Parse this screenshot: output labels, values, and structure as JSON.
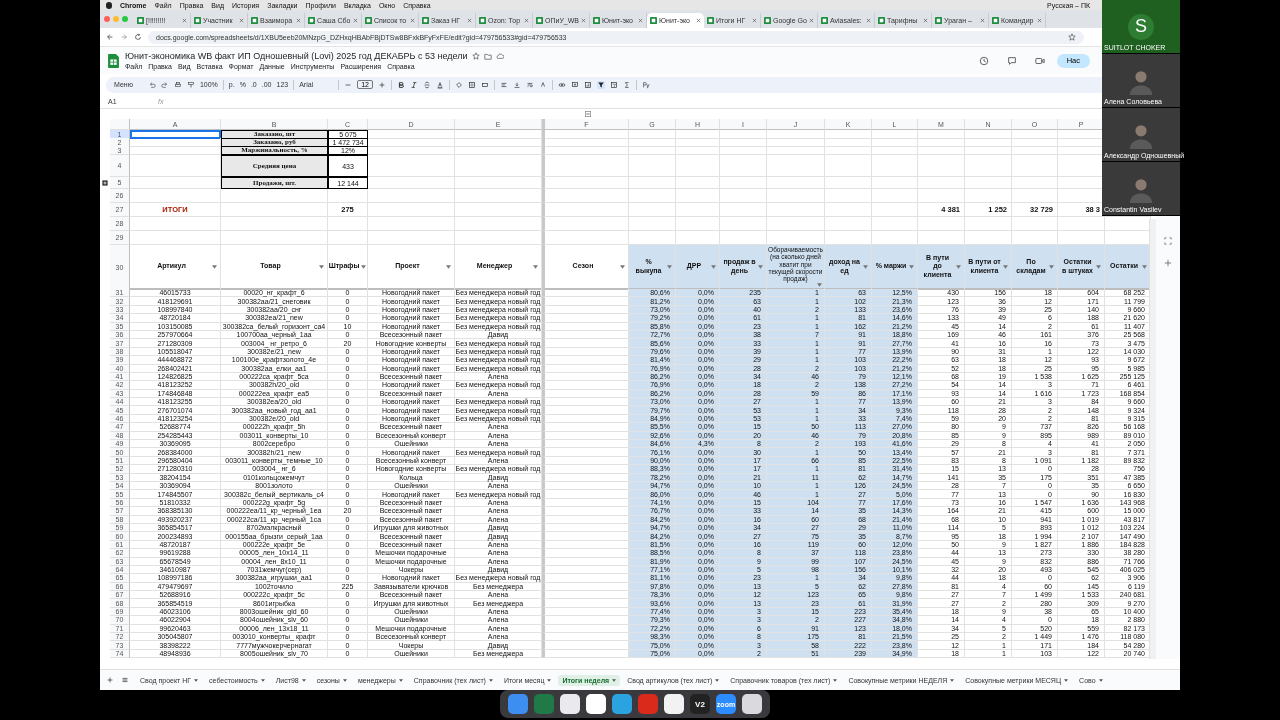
{
  "menubar": {
    "app": "Chrome",
    "items": [
      "Файл",
      "Правка",
      "Вид",
      "История",
      "Закладки",
      "Профили",
      "Вкладка",
      "Окно",
      "Справка"
    ],
    "input_source": "Русская – ПК"
  },
  "browser_tabs": [
    {
      "title": "[!!!!!!!!!",
      "selected": false
    },
    {
      "title": "Участник",
      "selected": false
    },
    {
      "title": "Взаимора",
      "selected": false
    },
    {
      "title": "Саша Сбо",
      "selected": false
    },
    {
      "title": "Список то",
      "selected": false
    },
    {
      "title": "Заказ НГ",
      "selected": false
    },
    {
      "title": "Ozon: Тор",
      "selected": false
    },
    {
      "title": "ОПиУ_WB",
      "selected": false
    },
    {
      "title": "Юнит-эко",
      "selected": false
    },
    {
      "title": "Юнит-эко",
      "selected": true
    },
    {
      "title": "Итоги НГ",
      "selected": false
    },
    {
      "title": "Google Go",
      "selected": false
    },
    {
      "title": "Aviasales:",
      "selected": false
    },
    {
      "title": "Тарифны",
      "selected": false
    },
    {
      "title": "Ураган –",
      "selected": false
    },
    {
      "title": "Командир",
      "selected": false
    }
  ],
  "address_bar": {
    "url": "docs.google.com/spreadsheets/d/1XBU5eeb20MNzpG_DZHxqHBAbFBjDTSw8BFxkBFyFxFE/edit?gid=479756533#gid=479756533"
  },
  "document": {
    "title": "Юнит-экономика WB факт ИП Одношевный (Lovi) 2025 год ДЕКАБРЬ с 53 недели",
    "menus": [
      "Файл",
      "Правка",
      "Вид",
      "Вставка",
      "Формат",
      "Данные",
      "Инструменты",
      "Расширения",
      "Справка"
    ],
    "share_label": "Нас"
  },
  "toolbar": {
    "search": "Меню",
    "zoom": "100%",
    "currency": "р.",
    "percent": "%",
    "decrease_decimals": ".0",
    "increase_decimals": ".00",
    "format": "123",
    "font": "Arial",
    "font_size": "12"
  },
  "formula_bar": {
    "cell": "A1",
    "fx": "fx"
  },
  "sheet": {
    "columns": [
      {
        "letter": "A",
        "header": "Артикул",
        "shaded": false,
        "header_shaded": false
      },
      {
        "letter": "B",
        "header": "Товар",
        "shaded": false,
        "header_shaded": false
      },
      {
        "letter": "C",
        "header": "Штрафы",
        "shaded": false,
        "header_shaded": false
      },
      {
        "letter": "D",
        "header": "Проект",
        "shaded": false,
        "header_shaded": false
      },
      {
        "letter": "E",
        "header": "Менеджер",
        "shaded": false,
        "header_shaded": false
      },
      {
        "letter": "F",
        "header": "Сезон",
        "shaded": false,
        "header_shaded": false
      },
      {
        "letter": "G",
        "header": "% выкупа",
        "shaded": true,
        "header_shaded": true
      },
      {
        "letter": "H",
        "header": "ДРР",
        "shaded": true,
        "header_shaded": true
      },
      {
        "letter": "I",
        "header": "продаж в день",
        "shaded": true,
        "header_shaded": true
      },
      {
        "letter": "J",
        "header": "Оборачиваемость (на сколько дней хватит при текущей скорости продаж)",
        "kind": "small",
        "shaded": true,
        "header_shaded": true
      },
      {
        "letter": "K",
        "header": "доход на ед",
        "shaded": true,
        "header_shaded": true
      },
      {
        "letter": "L",
        "header": "% маржи",
        "shaded": true,
        "header_shaded": true
      },
      {
        "letter": "M",
        "header": "В пути до клиента",
        "shaded": false,
        "header_shaded": true
      },
      {
        "letter": "N",
        "header": "В пути от клиента",
        "shaded": false,
        "header_shaded": true
      },
      {
        "letter": "O",
        "header": "По складам",
        "shaded": false,
        "header_shaded": true
      },
      {
        "letter": "P",
        "header": "Остатки в штуках",
        "shaded": false,
        "header_shaded": true
      },
      {
        "header": "Остатки",
        "shaded": false,
        "header_shaded": true
      }
    ],
    "summary": [
      {
        "row": "1",
        "label": "Заказано, шт",
        "value": "5 075"
      },
      {
        "row": "2",
        "label": "Заказано, руб",
        "value": "1 472 734"
      },
      {
        "row": "3",
        "label": "Маржинальность, %",
        "value": "12%"
      },
      {
        "row": "4",
        "label": "Средняя цена",
        "value": "433"
      },
      {
        "row": "5",
        "label": "Продажи, шт.",
        "value": "12 144"
      }
    ],
    "blank_rows_before": [
      "26"
    ],
    "totals": {
      "row": "27",
      "label": "ИТОГИ",
      "fines": "275",
      "to_client": "4 381",
      "from_client": "1 252",
      "warehouses": "32 729",
      "stock_units": "38 3"
    },
    "blank_rows_after": [
      "28",
      "29"
    ],
    "header_row": "30",
    "rows": [
      {
        "row": "31",
        "frozen": [
          "46015733",
          "00020_нг_крафт_6",
          "0",
          "Новогодний пакет",
          "Без менеджера новый год"
        ],
        "values": [
          "80,6%",
          "0,0%",
          "235",
          "1",
          "63",
          "12,5%",
          "430",
          "156",
          "18",
          "604",
          "68 252"
        ]
      },
      {
        "row": "32",
        "frozen": [
          "418129691",
          "300382aa/21_снеговик",
          "0",
          "Новогодний пакет",
          "Без менеджера новый год"
        ],
        "values": [
          "81,2%",
          "0,0%",
          "63",
          "1",
          "102",
          "21,3%",
          "123",
          "36",
          "12",
          "171",
          "11 799"
        ]
      },
      {
        "row": "33",
        "frozen": [
          "108997840",
          "300382aa/20_снг",
          "0",
          "Новогодний пакет",
          "Без менеджера новый год"
        ],
        "values": [
          "73,0%",
          "0,0%",
          "40",
          "2",
          "133",
          "23,6%",
          "76",
          "39",
          "25",
          "140",
          "9 660"
        ]
      },
      {
        "row": "34",
        "frozen": [
          "48720184",
          "300382ea/21_new",
          "0",
          "Новогодний пакет",
          "Без менеджера новый год"
        ],
        "values": [
          "79,2%",
          "0,0%",
          "61",
          "1",
          "81",
          "14,6%",
          "133",
          "49",
          "6",
          "188",
          "21 620"
        ]
      },
      {
        "row": "35",
        "frozen": [
          "103150085",
          "300382ca_белый_горизонт_ca4",
          "10",
          "Новогодний пакет",
          "Без менеджера новый год"
        ],
        "values": [
          "85,8%",
          "0,0%",
          "23",
          "1",
          "162",
          "21,2%",
          "45",
          "14",
          "2",
          "61",
          "11 407"
        ]
      },
      {
        "row": "36",
        "frozen": [
          "257970664",
          "100700aa_черный_1aa",
          "0",
          "Всесезонный пакет",
          "Давид"
        ],
        "values": [
          "72,7%",
          "0,0%",
          "38",
          "7",
          "91",
          "18,8%",
          "169",
          "46",
          "161",
          "376",
          "25 568"
        ]
      },
      {
        "row": "37",
        "frozen": [
          "271280309",
          "003004_ нг_ретро_6",
          "20",
          "Новогодние конверты",
          "Без менеджера новый год"
        ],
        "values": [
          "85,6%",
          "0,0%",
          "33",
          "1",
          "91",
          "27,7%",
          "41",
          "16",
          "16",
          "73",
          "3 475"
        ]
      },
      {
        "row": "38",
        "frozen": [
          "105518047",
          "300382e/21_new",
          "0",
          "Новогодний пакет",
          "Без менеджера новый год"
        ],
        "values": [
          "79,6%",
          "0,0%",
          "39",
          "1",
          "77",
          "13,9%",
          "90",
          "31",
          "1",
          "122",
          "14 030"
        ]
      },
      {
        "row": "39",
        "frozen": [
          "444468872",
          "100100e_крафтзолото_4e",
          "0",
          "Новогодний пакет",
          "Без менеджера новый год"
        ],
        "values": [
          "81,4%",
          "0,0%",
          "29",
          "1",
          "103",
          "22,2%",
          "63",
          "18",
          "12",
          "93",
          "9 672"
        ]
      },
      {
        "row": "40",
        "frozen": [
          "268402421",
          "300382aa_елки_aa1",
          "0",
          "Новогодний пакет",
          "Без менеджера новый год"
        ],
        "values": [
          "76,9%",
          "0,0%",
          "28",
          "2",
          "103",
          "21,2%",
          "52",
          "18",
          "25",
          "95",
          "5 985"
        ]
      },
      {
        "row": "41",
        "frozen": [
          "124826825",
          "000222ca_крафт_5ca",
          "0",
          "Всесезонный пакет",
          "Алена"
        ],
        "values": [
          "86,2%",
          "0,0%",
          "34",
          "46",
          "79",
          "12,1%",
          "68",
          "19",
          "1 538",
          "1 625",
          "255 125"
        ]
      },
      {
        "row": "42",
        "frozen": [
          "418123252",
          "300382h/20_old",
          "0",
          "Новогодний пакет",
          "Без менеджера новый год"
        ],
        "values": [
          "76,9%",
          "0,0%",
          "18",
          "2",
          "138",
          "27,2%",
          "54",
          "14",
          "3",
          "71",
          "6 461"
        ]
      },
      {
        "row": "43",
        "frozen": [
          "174846848",
          "000222ea_крафт_ea5",
          "0",
          "Всесезонный пакет",
          "Алена"
        ],
        "values": [
          "86,2%",
          "0,0%",
          "28",
          "59",
          "86",
          "17,1%",
          "93",
          "14",
          "1 616",
          "1 723",
          "168 854"
        ]
      },
      {
        "row": "44",
        "frozen": [
          "418123255",
          "300382ea/20_old",
          "0",
          "Новогодний пакет",
          "Без менеджера новый год"
        ],
        "values": [
          "73,0%",
          "0,0%",
          "27",
          "1",
          "77",
          "13,9%",
          "60",
          "21",
          "3",
          "84",
          "9 660"
        ]
      },
      {
        "row": "45",
        "frozen": [
          "276701074",
          "300382aa_новый_год_aa1",
          "0",
          "Новогодний пакет",
          "Без менеджера новый год"
        ],
        "values": [
          "79,7%",
          "0,0%",
          "53",
          "1",
          "34",
          "9,3%",
          "118",
          "28",
          "2",
          "148",
          "9 324"
        ]
      },
      {
        "row": "46",
        "frozen": [
          "418123254",
          "300382e/20_old",
          "0",
          "Новогодний пакет",
          "Без менеджера новый год"
        ],
        "values": [
          "84,9%",
          "0,0%",
          "53",
          "1",
          "33",
          "7,4%",
          "59",
          "20",
          "2",
          "81",
          "9 315"
        ]
      },
      {
        "row": "47",
        "frozen": [
          "52688774",
          "000222h_крафт_5h",
          "0",
          "Всесезонный пакет",
          "Алена"
        ],
        "values": [
          "85,5%",
          "0,0%",
          "15",
          "50",
          "113",
          "27,0%",
          "80",
          "9",
          "737",
          "826",
          "56 168"
        ]
      },
      {
        "row": "48",
        "frozen": [
          "254285443",
          "003011_конверты_10",
          "0",
          "Всесезонный конверт",
          "Алена"
        ],
        "values": [
          "92,6%",
          "0,0%",
          "20",
          "46",
          "79",
          "20,8%",
          "85",
          "9",
          "895",
          "989",
          "89 010"
        ]
      },
      {
        "row": "49",
        "frozen": [
          "30369095",
          "8002серебро",
          "0",
          "Ошейники",
          "Алена"
        ],
        "values": [
          "84,6%",
          "4,3%",
          "8",
          "2",
          "193",
          "41,6%",
          "29",
          "8",
          "4",
          "41",
          "2 050"
        ]
      },
      {
        "row": "50",
        "frozen": [
          "268384000",
          "300382h/21_new",
          "0",
          "Новогодний пакет",
          "Без менеджера новый год"
        ],
        "values": [
          "76,1%",
          "0,0%",
          "30",
          "1",
          "50",
          "13,4%",
          "57",
          "21",
          "3",
          "81",
          "7 371"
        ]
      },
      {
        "row": "51",
        "frozen": [
          "296580404",
          "003011_конверты_темные_10",
          "0",
          "Всесезонный конверт",
          "Алена"
        ],
        "values": [
          "90,0%",
          "0,0%",
          "17",
          "66",
          "85",
          "22,5%",
          "83",
          "8",
          "1 091",
          "1 182",
          "89 832"
        ]
      },
      {
        "row": "52",
        "frozen": [
          "271280310",
          "003004_ нг_6",
          "0",
          "Новогодние конверты",
          "Без менеджера новый год"
        ],
        "values": [
          "88,3%",
          "0,0%",
          "17",
          "1",
          "81",
          "31,4%",
          "15",
          "13",
          "0",
          "28",
          "756"
        ]
      },
      {
        "row": "53",
        "frozen": [
          "38204154",
          "0101кольцожемчут",
          "0",
          "Кольца",
          "Давид"
        ],
        "values": [
          "78,2%",
          "0,0%",
          "21",
          "11",
          "62",
          "14,7%",
          "141",
          "35",
          "175",
          "351",
          "47 385"
        ]
      },
      {
        "row": "54",
        "frozen": [
          "30369094",
          "8001золото",
          "0",
          "Ошейники",
          "Алена"
        ],
        "values": [
          "94,7%",
          "0,0%",
          "10",
          "1",
          "126",
          "24,5%",
          "28",
          "7",
          "0",
          "35",
          "6 650"
        ]
      },
      {
        "row": "55",
        "frozen": [
          "174845507",
          "300382c_белый_вертикаль_c4",
          "0",
          "Новогодний пакет",
          "Без менеджера новый год"
        ],
        "values": [
          "86,0%",
          "0,0%",
          "46",
          "1",
          "27",
          "5,0%",
          "77",
          "13",
          "0",
          "90",
          "16 830"
        ]
      },
      {
        "row": "56",
        "frozen": [
          "51810332",
          "000222g_крафт_5g",
          "0",
          "Всесезонный пакет",
          "Алена"
        ],
        "values": [
          "74,1%",
          "0,0%",
          "15",
          "104",
          "77",
          "17,6%",
          "73",
          "16",
          "1 547",
          "1 636",
          "143 968"
        ]
      },
      {
        "row": "57",
        "frozen": [
          "368385130",
          "000222ea/11_кр_черный_1ea",
          "20",
          "Всесезонный пакет",
          "Алена"
        ],
        "values": [
          "76,7%",
          "0,0%",
          "33",
          "14",
          "35",
          "14,3%",
          "164",
          "21",
          "415",
          "600",
          "15 000"
        ]
      },
      {
        "row": "58",
        "frozen": [
          "493920237",
          "000222ca/11_кр_черный_1ca",
          "0",
          "Всесезонный пакет",
          "Алена"
        ],
        "values": [
          "84,2%",
          "0,0%",
          "16",
          "60",
          "68",
          "21,4%",
          "68",
          "10",
          "941",
          "1 019",
          "43 817"
        ]
      },
      {
        "row": "59",
        "frozen": [
          "365854517",
          "8702мэлкрасный",
          "0",
          "Игрушки для животных",
          "Давид"
        ],
        "values": [
          "94,7%",
          "0,0%",
          "34",
          "27",
          "29",
          "11,0%",
          "114",
          "5",
          "893",
          "1 012",
          "103 224"
        ]
      },
      {
        "row": "60",
        "frozen": [
          "200234893",
          "000155aa_брызги_серый_1aa",
          "0",
          "Всесезонный пакет",
          "Давид"
        ],
        "values": [
          "84,2%",
          "0,0%",
          "27",
          "75",
          "35",
          "8,7%",
          "95",
          "18",
          "1 994",
          "2 107",
          "147 490"
        ]
      },
      {
        "row": "61",
        "frozen": [
          "48720187",
          "000222e_крафт_5e",
          "0",
          "Всесезонный пакет",
          "Алена"
        ],
        "values": [
          "81,5%",
          "0,0%",
          "16",
          "119",
          "60",
          "12,0%",
          "50",
          "9",
          "1 827",
          "1 886",
          "184 828"
        ]
      },
      {
        "row": "62",
        "frozen": [
          "99619288",
          "00005_лен_10x14_11",
          "0",
          "Мешочки подарочные",
          "Алена"
        ],
        "values": [
          "88,5%",
          "0,0%",
          "8",
          "37",
          "118",
          "23,8%",
          "44",
          "13",
          "273",
          "330",
          "38 280"
        ]
      },
      {
        "row": "63",
        "frozen": [
          "65678549",
          "00004_лен_8x10_11",
          "0",
          "Мешочки подарочные",
          "Алена"
        ],
        "values": [
          "81,9%",
          "0,0%",
          "9",
          "99",
          "107",
          "24,5%",
          "45",
          "9",
          "832",
          "886",
          "71 766"
        ]
      },
      {
        "row": "64",
        "frozen": [
          "34610987",
          "7031жемчуг(сер)",
          "0",
          "Чокеры",
          "Давид"
        ],
        "values": [
          "77,1%",
          "0,0%",
          "5",
          "98",
          "156",
          "10,1%",
          "32",
          "20",
          "493",
          "545",
          "406 025"
        ]
      },
      {
        "row": "65",
        "frozen": [
          "108997186",
          "300382aa_игрушки_aa1",
          "0",
          "Новогодний пакет",
          "Без менеджера новый год"
        ],
        "values": [
          "81,1%",
          "0,0%",
          "23",
          "1",
          "34",
          "9,8%",
          "44",
          "18",
          "0",
          "62",
          "3 906"
        ]
      },
      {
        "row": "66",
        "frozen": [
          "479479697",
          "1002точило",
          "225",
          "Завязыватели крючков",
          "Без менеджера"
        ],
        "values": [
          "97,8%",
          "0,0%",
          "13",
          "5",
          "62",
          "27,8%",
          "81",
          "4",
          "60",
          "145",
          "6 119"
        ]
      },
      {
        "row": "67",
        "frozen": [
          "52688916",
          "000222c_крафт_5c",
          "0",
          "Всесезонный пакет",
          "Алена"
        ],
        "values": [
          "78,3%",
          "0,0%",
          "12",
          "123",
          "65",
          "9,8%",
          "27",
          "7",
          "1 499",
          "1 533",
          "240 681"
        ]
      },
      {
        "row": "68",
        "frozen": [
          "365854519",
          "8601игрыбка",
          "0",
          "Игрушки для животных",
          "Без менеджера"
        ],
        "values": [
          "93,6%",
          "0,0%",
          "13",
          "23",
          "61",
          "31,9%",
          "27",
          "2",
          "280",
          "309",
          "9 270"
        ]
      },
      {
        "row": "69",
        "frozen": [
          "46023106",
          "8003ошейник_gld_60",
          "0",
          "Ошейники",
          "Алена"
        ],
        "values": [
          "77,4%",
          "0,0%",
          "3",
          "15",
          "223",
          "35,4%",
          "18",
          "9",
          "38",
          "65",
          "10 400"
        ]
      },
      {
        "row": "70",
        "frozen": [
          "46022904",
          "8004ошейник_slv_60",
          "0",
          "Ошейники",
          "Алена"
        ],
        "values": [
          "79,3%",
          "0,0%",
          "3",
          "2",
          "227",
          "34,8%",
          "14",
          "4",
          "0",
          "18",
          "2 880"
        ]
      },
      {
        "row": "71",
        "frozen": [
          "99620463",
          "00006_лен_13x18_11",
          "0",
          "Мешочки подарочные",
          "Алена"
        ],
        "values": [
          "72,2%",
          "0,0%",
          "6",
          "91",
          "123",
          "18,0%",
          "34",
          "5",
          "520",
          "559",
          "82 173"
        ]
      },
      {
        "row": "72",
        "frozen": [
          "305045807",
          "003010_конверты_ крафт",
          "0",
          "Всесезонный конверт",
          "Алена"
        ],
        "values": [
          "98,3%",
          "0,0%",
          "8",
          "175",
          "81",
          "21,5%",
          "25",
          "2",
          "1 449",
          "1 476",
          "118 080"
        ]
      },
      {
        "row": "73",
        "frozen": [
          "38398222",
          "7777мужчокерчернагат",
          "0",
          "Чокеры",
          "Давид"
        ],
        "values": [
          "75,0%",
          "0,0%",
          "3",
          "58",
          "222",
          "23,8%",
          "12",
          "1",
          "171",
          "184",
          "54 280"
        ]
      },
      {
        "row": "74",
        "frozen": [
          "48948936",
          "8005ошейник_slv_70",
          "0",
          "Ошейники",
          "Без менеджера"
        ],
        "values": [
          "75,0%",
          "0,0%",
          "2",
          "51",
          "239",
          "34,9%",
          "18",
          "1",
          "103",
          "122",
          "20 740"
        ]
      }
    ]
  },
  "sheet_tabs": [
    {
      "label": "Свод проект НГ",
      "selected": false
    },
    {
      "label": "себестоимость",
      "selected": false
    },
    {
      "label": "Лист98",
      "selected": false
    },
    {
      "label": "сезоны",
      "selected": false
    },
    {
      "label": "менеджеры",
      "selected": false
    },
    {
      "label": "Справочник (тех лист)",
      "selected": false
    },
    {
      "label": "Итоги месяц",
      "selected": false
    },
    {
      "label": "Итоги неделя",
      "selected": true
    },
    {
      "label": "Свод артикулов (тех лист)",
      "selected": false
    },
    {
      "label": "Справочник товаров (тех лист)",
      "selected": false
    },
    {
      "label": "Совокупные метрики НЕДЕЛЯ",
      "selected": false
    },
    {
      "label": "Совокупные метрики МЕСЯЦ",
      "selected": false
    },
    {
      "label": "Сово",
      "selected": false
    }
  ],
  "participants": [
    {
      "kind": "avatar",
      "initial": "S",
      "name": "SUITLOT CHOKER"
    },
    {
      "kind": "video",
      "name": "Алена Соловьева"
    },
    {
      "kind": "video",
      "name": "Александр Одношевный"
    },
    {
      "kind": "video",
      "name": "Constantin Vasilev"
    }
  ],
  "dock": [
    {
      "kind": "finder"
    },
    {
      "kind": "excel"
    },
    {
      "kind": "launchpad"
    },
    {
      "kind": "chrome"
    },
    {
      "kind": "telegram"
    },
    {
      "kind": "acrobat"
    },
    {
      "kind": "apps"
    },
    {
      "kind": "text",
      "label": "V2"
    },
    {
      "kind": "zoom",
      "label": "zoom"
    },
    {
      "kind": "trash"
    }
  ]
}
